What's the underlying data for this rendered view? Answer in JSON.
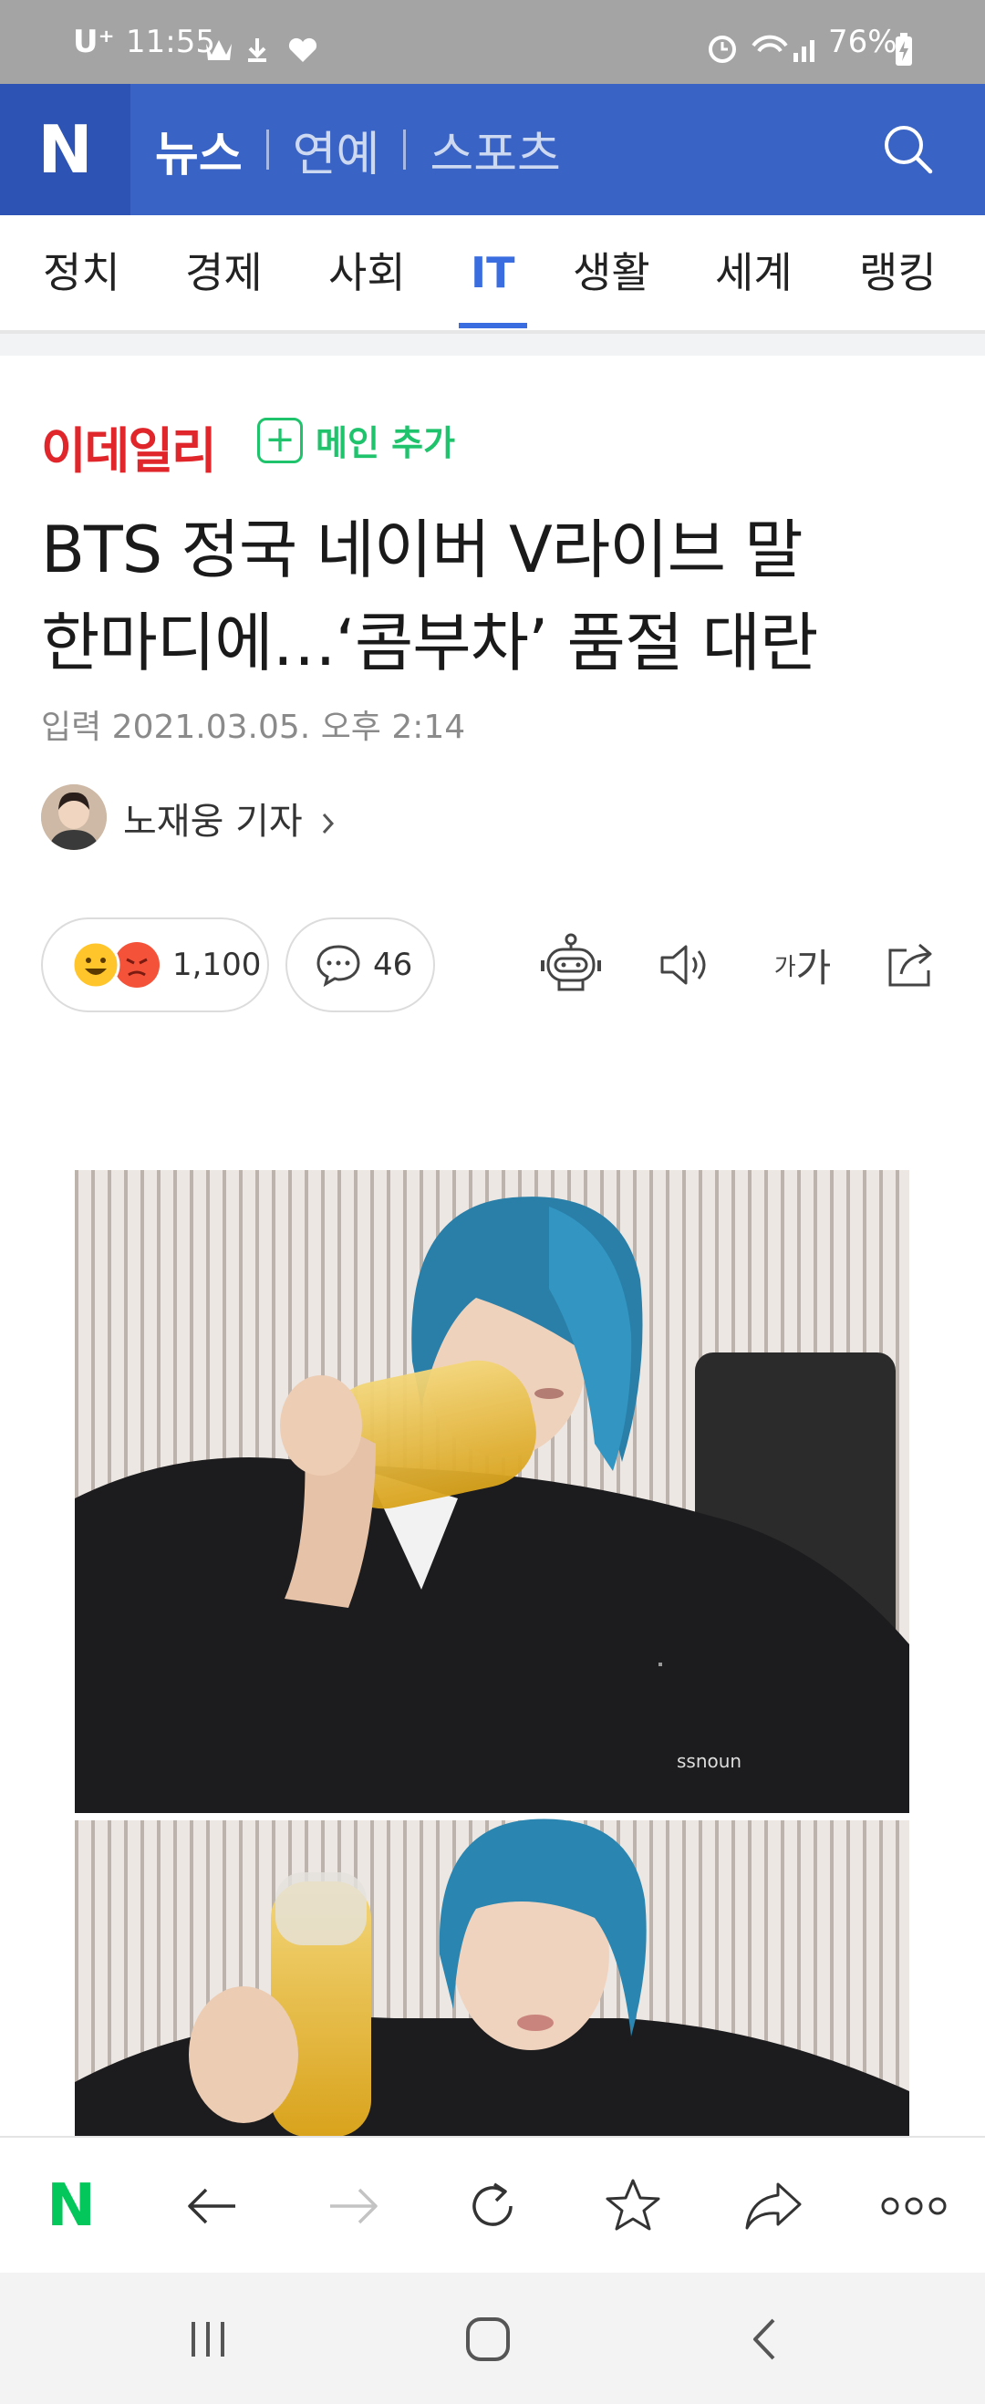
{
  "status_bar": {
    "carrier": "U⁺",
    "time": "11:55",
    "battery": "76%"
  },
  "header": {
    "logo": "N",
    "tabs": [
      "뉴스",
      "연예",
      "스포츠"
    ]
  },
  "sections": [
    "정치",
    "경제",
    "사회",
    "IT",
    "생활",
    "세계",
    "랭킹"
  ],
  "active_section": "IT",
  "article": {
    "press": "이데일리",
    "main_add_label": "메인 추가",
    "title_line1": "BTS 정국 네이버 V라이브 말",
    "title_line2": "한마디에…‘콤부차’ 품절 대란",
    "date": "입력 2021.03.05. 오후 2:14",
    "reporter": "노재웅 기자",
    "reaction_count": "1,100",
    "comment_count": "46",
    "font_size_label_small": "가",
    "font_size_label_big": "가"
  },
  "colors": {
    "naver_blue": "#3a63c6",
    "naver_green": "#03c75a",
    "active_tab": "#3a6ee0",
    "press_red": "#e0262b"
  },
  "icons": [
    "search-icon",
    "robot-summary-icon",
    "speaker-icon",
    "share-icon",
    "back-arrow-icon",
    "forward-arrow-icon",
    "refresh-icon",
    "star-icon",
    "share-arrow-icon",
    "more-icon"
  ]
}
